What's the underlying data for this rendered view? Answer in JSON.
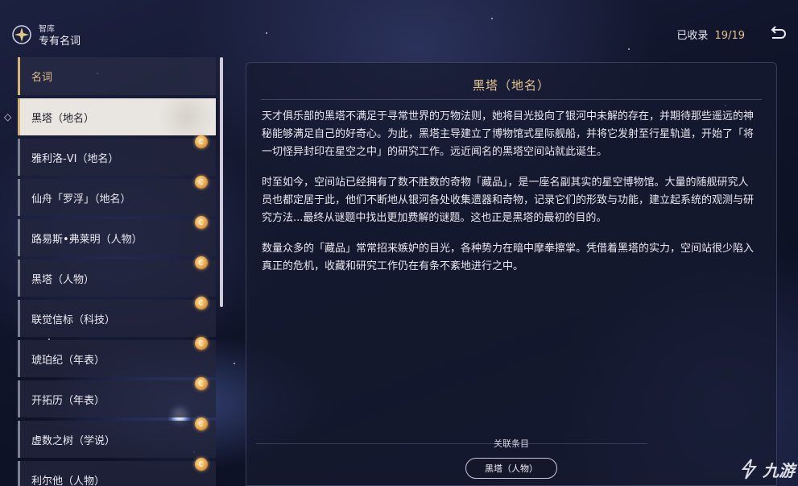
{
  "header": {
    "small_label": "智库",
    "title": "专有名词",
    "collected_label": "已收录",
    "collected_count": "19/19"
  },
  "list": {
    "header": "名词",
    "items": [
      {
        "label": "黑塔（地名）",
        "selected": true
      },
      {
        "label": "雅利洛-VI（地名）"
      },
      {
        "label": "仙舟「罗浮」（地名）"
      },
      {
        "label": "路易斯•弗莱明（人物）"
      },
      {
        "label": "黑塔（人物）"
      },
      {
        "label": "联觉信标（科技）"
      },
      {
        "label": "琥珀纪（年表）"
      },
      {
        "label": "开拓历（年表）"
      },
      {
        "label": "虚数之树（学说）"
      },
      {
        "label": "利尔他（人物）"
      }
    ]
  },
  "detail": {
    "title": "黑塔（地名）",
    "paragraphs": [
      "天才俱乐部的黑塔不满足于寻常世界的万物法则，她将目光投向了银河中未解的存在，并期待那些遥远的神秘能够满足自己的好奇心。为此，黑塔主导建立了博物馆式星际舰船，并将它发射至行星轨道，开始了「将一切怪异封印在星空之中」的研究工作。远近闻名的黑塔空间站就此诞生。",
      "时至如今，空间站已经拥有了数不胜数的奇物「藏品」，是一座名副其实的星空博物馆。大量的随舰研究人员也都定居于此，他们不断地从银河各处收集遗器和奇物，记录它们的形致与功能，建立起系统的观测与研究方法...最终从谜题中找出更加费解的谜题。这也正是黑塔的最初的目的。",
      "数量众多的「藏品」常常招来嫉妒的目光，各种势力在暗中摩拳擦掌。凭借着黑塔的实力，空间站很少陷入真正的危机，收藏和研究工作仍在有条不紊地进行之中。"
    ],
    "related_label": "关联条目",
    "related_items": [
      "黑塔（人物）"
    ]
  },
  "watermark": {
    "text": "九游"
  },
  "colors": {
    "accent_gold": "#e2c48a",
    "selected_bg": "#e9e6e1",
    "badge": "#e6a24a"
  },
  "icons": {
    "logo": "archive-star-icon",
    "back": "return-arrow-icon",
    "new_badge": "new-entry-badge-icon",
    "selected_marker": "selection-diamond-icon"
  }
}
